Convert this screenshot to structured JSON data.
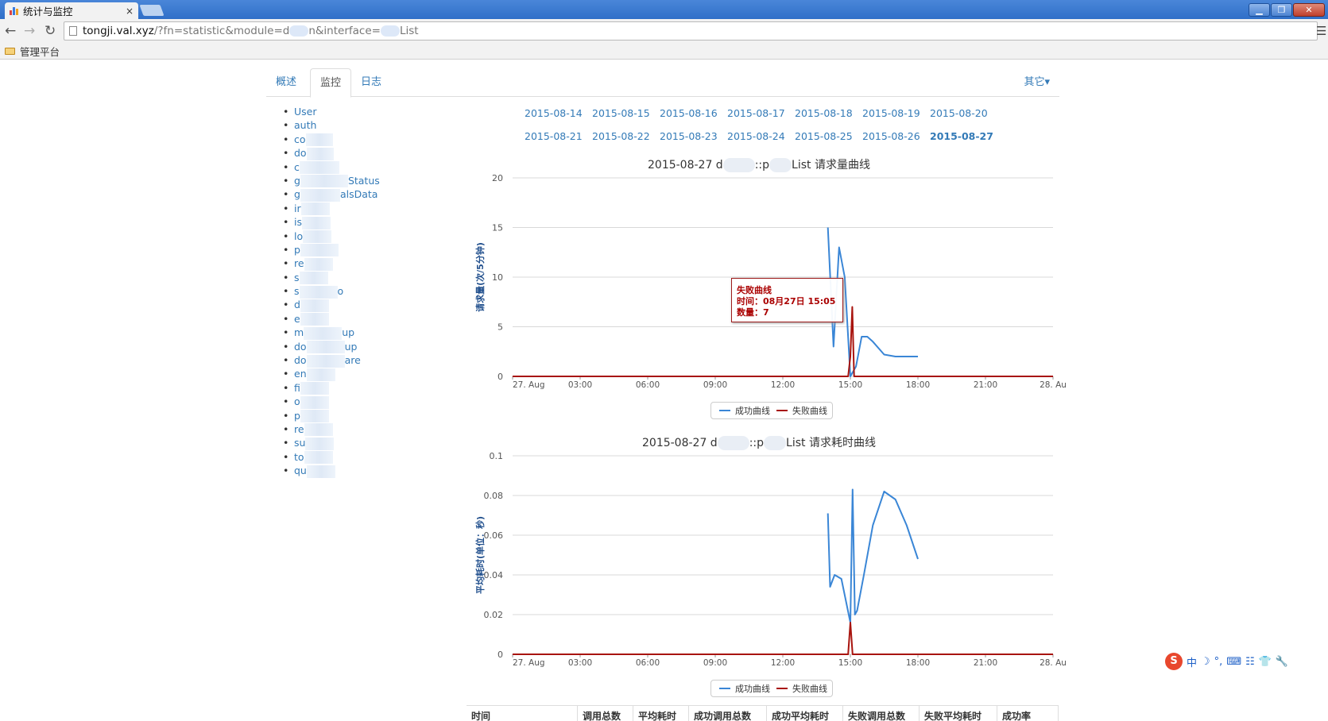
{
  "browser": {
    "tab_title": "统计与监控",
    "tab_close": "×",
    "url_host": "tongji.val.xyz",
    "url_path": "/?fn=statistic&module=d",
    "url_rest": "n&interface=",
    "url_end": "List",
    "bookmark_label": "管理平台",
    "window_buttons": {
      "minimize": "▁",
      "maximize": "❐",
      "close": "✕"
    },
    "icons": {
      "back": "back-arrow-icon",
      "forward": "forward-arrow-icon",
      "reload": "reload-icon",
      "menu": "hamburger-menu-icon",
      "folder": "folder-icon"
    }
  },
  "nav_tabs": {
    "overview": "概述",
    "monitor": "监控",
    "log": "日志",
    "other": "其它",
    "other_caret": "▾"
  },
  "modules": [
    {
      "text": "User"
    },
    {
      "text": "auth"
    },
    {
      "text": "co"
    },
    {
      "text": "do"
    },
    {
      "text": "c"
    },
    {
      "text": "g",
      "suffix": "Status"
    },
    {
      "text": "g",
      "suffix": "alsData"
    },
    {
      "text": "ir"
    },
    {
      "text": "is"
    },
    {
      "text": "lo"
    },
    {
      "text": "p"
    },
    {
      "text": "re"
    },
    {
      "text": "s"
    },
    {
      "text": "s",
      "suffix": "o"
    },
    {
      "text": "d"
    },
    {
      "text": "e"
    },
    {
      "text": "m",
      "suffix": "up"
    },
    {
      "text": "do",
      "suffix": "up"
    },
    {
      "text": "do",
      "suffix": "are"
    },
    {
      "text": "en"
    },
    {
      "text": "fi"
    },
    {
      "text": "o"
    },
    {
      "text": "p"
    },
    {
      "text": "re"
    },
    {
      "text": "su"
    },
    {
      "text": "to"
    },
    {
      "text": "qu"
    }
  ],
  "dates": {
    "row1": [
      "2015-08-14",
      "2015-08-15",
      "2015-08-16",
      "2015-08-17",
      "2015-08-18",
      "2015-08-19",
      "2015-08-20"
    ],
    "row2": [
      "2015-08-21",
      "2015-08-22",
      "2015-08-23",
      "2015-08-24",
      "2015-08-25",
      "2015-08-26",
      "2015-08-27"
    ],
    "current": "2015-08-27"
  },
  "chart_data": [
    {
      "type": "line",
      "title_parts": [
        "2015-08-27 d",
        "::p",
        "List 请求量曲线"
      ],
      "ylabel": "请求量(次/5分钟)",
      "ylim": [
        0,
        20
      ],
      "yticks": [
        "0",
        "5",
        "10",
        "15",
        "20"
      ],
      "xlabels": [
        "27. Aug",
        "03:00",
        "06:00",
        "09:00",
        "12:00",
        "15:00",
        "18:00",
        "21:00",
        "28. Au"
      ],
      "xlim_hours": [
        0,
        24
      ],
      "series": [
        {
          "name": "成功曲线",
          "color": "#3a86d6",
          "x": [
            14.0,
            14.25,
            14.5,
            14.75,
            15.0,
            15.25,
            15.5,
            15.75,
            16.0,
            16.5,
            17.0,
            17.5,
            18.0
          ],
          "y": [
            15,
            3,
            13,
            10,
            0,
            1,
            4,
            4,
            3.5,
            2.2,
            2,
            2,
            2
          ]
        },
        {
          "name": "失败曲线",
          "color": "#a8140e",
          "x": [
            0,
            14.9,
            15.0,
            15.083,
            15.167,
            24
          ],
          "y": [
            0,
            0,
            2,
            7,
            0,
            0
          ]
        }
      ],
      "legend_placement": "bottom"
    },
    {
      "type": "line",
      "title_parts": [
        "2015-08-27 d",
        "::p",
        "List 请求耗时曲线"
      ],
      "ylabel": "平均耗时(单位：秒)",
      "ylim": [
        0,
        0.1
      ],
      "yticks": [
        "0",
        "0.02",
        "0.04",
        "0.06",
        "0.08",
        "0.1"
      ],
      "xlabels": [
        "27. Aug",
        "03:00",
        "06:00",
        "09:00",
        "12:00",
        "15:00",
        "18:00",
        "21:00",
        "28. Au"
      ],
      "xlim_hours": [
        0,
        24
      ],
      "series": [
        {
          "name": "成功曲线",
          "color": "#3a86d6",
          "x": [
            14.0,
            14.1,
            14.3,
            14.6,
            15.0,
            15.1,
            15.2,
            15.3,
            15.6,
            16.0,
            16.5,
            17.0,
            17.5,
            18.0
          ],
          "y": [
            0.071,
            0.034,
            0.04,
            0.038,
            0.016,
            0.083,
            0.02,
            0.022,
            0.04,
            0.065,
            0.082,
            0.078,
            0.065,
            0.048
          ]
        },
        {
          "name": "失败曲线",
          "color": "#a8140e",
          "x": [
            0,
            14.9,
            15.0,
            15.1,
            24
          ],
          "y": [
            0,
            0,
            0.016,
            0,
            0
          ]
        }
      ],
      "legend_placement": "bottom"
    }
  ],
  "tooltip": {
    "title": "失败曲线",
    "time": "时间：08月27日 15:05",
    "count": "数量：7"
  },
  "table_headers": [
    "时间",
    "调用总数",
    "平均耗时",
    "成功调用总数",
    "成功平均耗时",
    "失败调用总数",
    "失败平均耗时",
    "成功率"
  ],
  "ime": {
    "logo": "S",
    "items": [
      "中",
      "☽",
      "°,",
      "⌨",
      "☷",
      "👕",
      "🔧"
    ]
  }
}
